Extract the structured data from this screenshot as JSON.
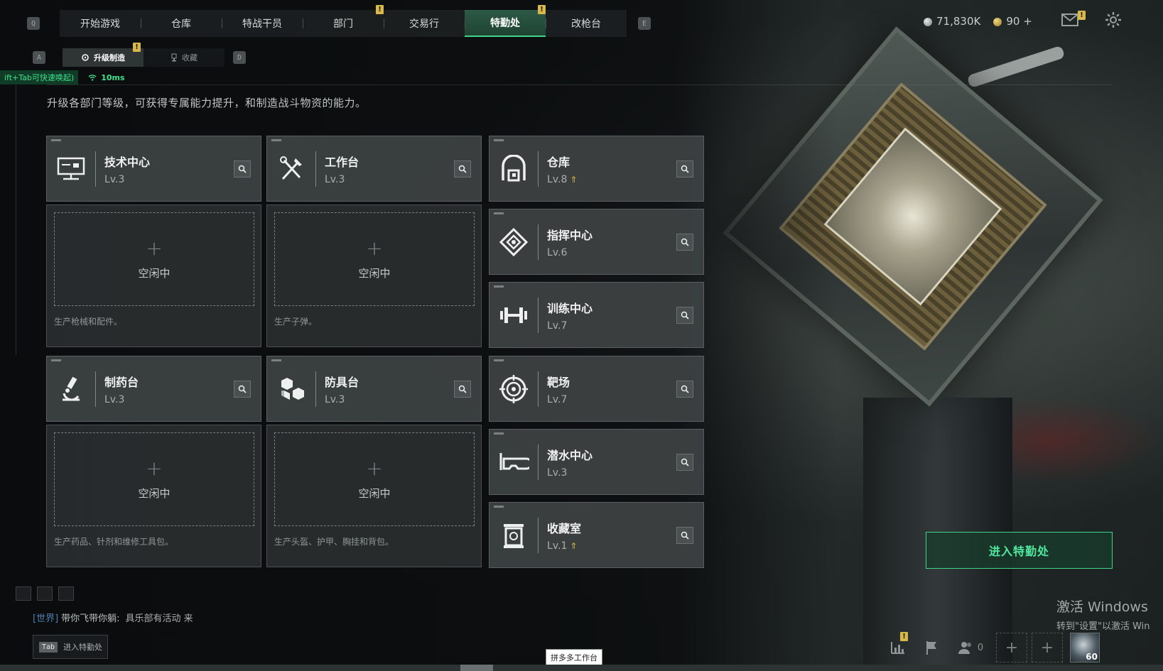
{
  "top_nav": {
    "left_key": "Q",
    "right_key": "E",
    "tabs": [
      {
        "label": "开始游戏",
        "badge": null
      },
      {
        "label": "仓库",
        "badge": null
      },
      {
        "label": "特战干员",
        "badge": null
      },
      {
        "label": "部门",
        "badge": "!"
      },
      {
        "label": "交易行",
        "badge": null
      },
      {
        "label": "特勤处",
        "badge": "!",
        "active": true
      },
      {
        "label": "改枪台",
        "badge": null
      }
    ]
  },
  "resources": {
    "silver": "71,830K",
    "gold": "90",
    "gold_add": "+"
  },
  "mail_badge": "!",
  "sub_nav": {
    "left_key": "A",
    "right_key": "D",
    "tabs": [
      {
        "label": "升级制造",
        "active": true,
        "badge": "!"
      },
      {
        "label": "收藏",
        "active": false
      }
    ]
  },
  "network": {
    "shift_hint": "ift+Tab可快速唤起)",
    "ping": "10ms"
  },
  "description": "升级各部门等级，可获得专属能力提升，和制造战斗物资的能力。",
  "production_departments": [
    {
      "name": "技术中心",
      "level": "Lv.3",
      "icon": "monitor-icon",
      "slot_label": "空闲中",
      "desc": "生产枪械和配件。"
    },
    {
      "name": "工作台",
      "level": "Lv.3",
      "icon": "tools-icon",
      "slot_label": "空闲中",
      "desc": "生产子弹。"
    },
    {
      "name": "制药台",
      "level": "Lv.3",
      "icon": "microscope-icon",
      "slot_label": "空闲中",
      "desc": "生产药品、针剂和维修工具包。"
    },
    {
      "name": "防具台",
      "level": "Lv.3",
      "icon": "armor-icon",
      "slot_label": "空闲中",
      "desc": "生产头盔、护甲、胸挂和背包。"
    }
  ],
  "facilities": [
    {
      "name": "仓库",
      "level": "Lv.8",
      "icon": "warehouse-icon",
      "upgradable": true
    },
    {
      "name": "指挥中心",
      "level": "Lv.6",
      "icon": "command-icon",
      "upgradable": false
    },
    {
      "name": "训练中心",
      "level": "Lv.7",
      "icon": "dumbbell-icon",
      "upgradable": false
    },
    {
      "name": "靶场",
      "level": "Lv.7",
      "icon": "target-icon",
      "upgradable": false
    },
    {
      "name": "潜水中心",
      "level": "Lv.3",
      "icon": "diving-mask-icon",
      "upgradable": false
    },
    {
      "name": "收藏室",
      "level": "Lv.1",
      "icon": "collection-icon",
      "upgradable": true
    }
  ],
  "enter_button": "进入特勤处",
  "chat": {
    "channel": "[世界]",
    "sender": "带你飞带你躺:",
    "message": "具乐部有活动    来"
  },
  "tab_hint": {
    "key": "Tab",
    "label": "进入特勤处"
  },
  "taskbar_tooltip": "拼多多工作台",
  "watermark": {
    "line1": "激活 Windows",
    "line2": "转到\"设置\"以激活 Win"
  },
  "bottom_right": {
    "stats_badge": "!",
    "friends_count": "0",
    "avatar_level": "60"
  },
  "colors": {
    "accent_green": "#3fd48c",
    "badge_yellow": "#d8b84a",
    "card_bg": "#3e4243"
  }
}
